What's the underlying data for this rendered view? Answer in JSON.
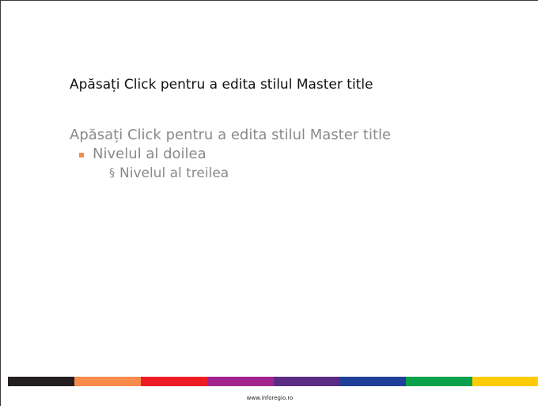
{
  "slide": {
    "title": "Apăsați Click pentru a edita stilul Master title",
    "body": {
      "level1": "Apăsați Click pentru a edita stilul Master title",
      "level2": "Nivelul al doilea",
      "level3_marker": "§",
      "level3": "Nivelul al treilea"
    },
    "color_bar": [
      "#231f20",
      "#f68b4b",
      "#ed1c24",
      "#a3238e",
      "#5b2c83",
      "#1f3f99",
      "#0ba14b",
      "#ffcb05"
    ],
    "bullet_color": "#f28c50",
    "footer": "www.inforegio.ro"
  }
}
